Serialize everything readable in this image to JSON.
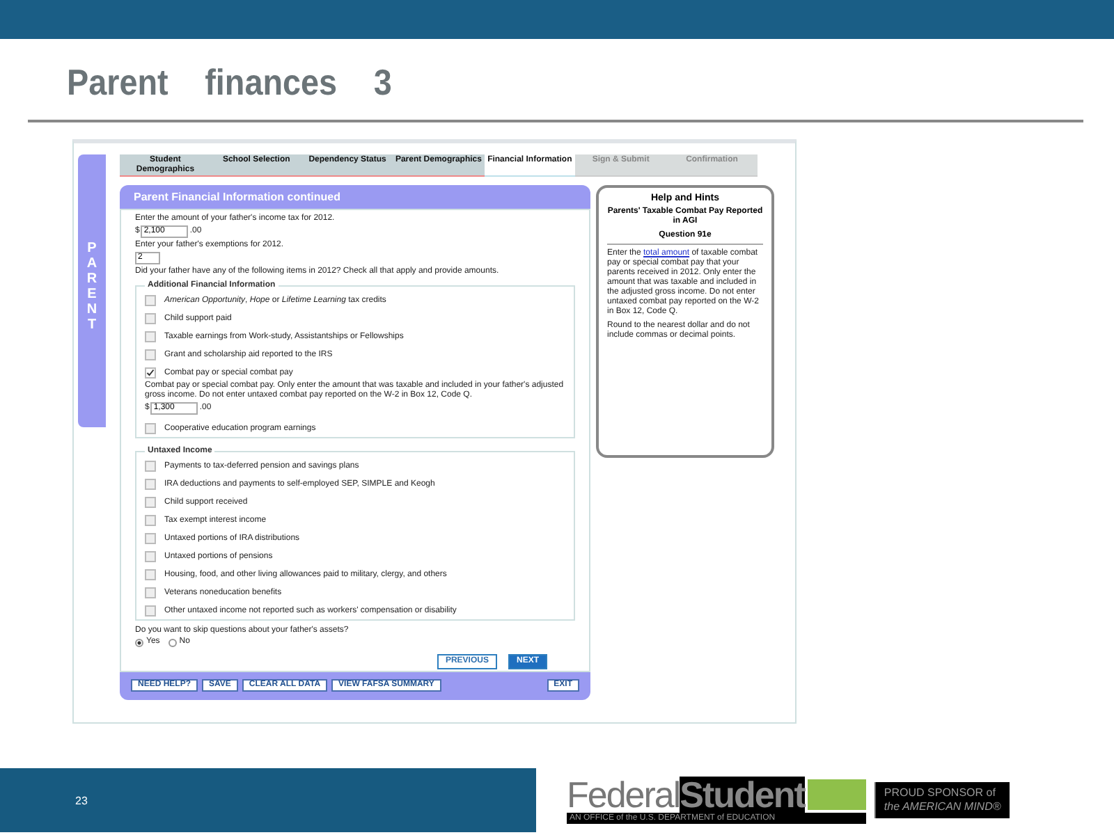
{
  "slide": {
    "title": "Parent finances 3",
    "page_number": "23"
  },
  "side_tab": {
    "label": "PARENT"
  },
  "wizard_steps": [
    {
      "label": "Student Demographics",
      "selected": false,
      "disabled": false
    },
    {
      "label": "School Selection",
      "selected": false,
      "disabled": false
    },
    {
      "label": "Dependency Status",
      "selected": false,
      "disabled": false
    },
    {
      "label": "Parent Demographics",
      "selected": false,
      "disabled": false
    },
    {
      "label": "Financial Information",
      "selected": true,
      "disabled": false
    },
    {
      "label": "Sign & Submit",
      "selected": false,
      "disabled": true
    },
    {
      "label": "Confirmation",
      "selected": false,
      "disabled": true
    }
  ],
  "form": {
    "heading": "Parent Financial Information continued",
    "questions": [
      {
        "label": "Enter the amount of your father's income tax for 2012.",
        "prefix": "$",
        "value": "2,100",
        "suffix": ".00"
      },
      {
        "label": "Enter your father's exemptions for 2012.",
        "value": "2"
      }
    ],
    "intro": "Did your father have any of the following items in 2012? Check all that apply and provide amounts.",
    "fieldsets": [
      {
        "legend": "Additional Financial Information",
        "items": [
          {
            "label": "*American Opportunity*, *Hope* or *Lifetime Learning* tax credits",
            "checked": false
          },
          {
            "label": "Child support paid",
            "checked": false
          },
          {
            "label": "Taxable earnings from Work-study, Assistantships or Fellowships",
            "checked": false
          },
          {
            "label": "Grant and scholarship aid reported to the IRS",
            "checked": false
          },
          {
            "label": "Combat pay or special combat pay",
            "checked": true,
            "detail": {
              "text": "Combat pay or special combat pay. Only enter the amount that was taxable and included in your father's adjusted gross income. Do not enter untaxed combat pay reported on the W-2 in Box 12, Code Q.",
              "prefix": "$",
              "value": "1,300",
              "suffix": ".00"
            }
          },
          {
            "label": "Cooperative education program earnings",
            "checked": false
          }
        ]
      },
      {
        "legend": "Untaxed Income",
        "items": [
          {
            "label": "Payments to tax-deferred pension and savings plans",
            "checked": false
          },
          {
            "label": "IRA deductions and payments to self-employed SEP, SIMPLE and Keogh",
            "checked": false
          },
          {
            "label": "Child support received",
            "checked": false
          },
          {
            "label": "Tax exempt interest income",
            "checked": false
          },
          {
            "label": "Untaxed portions of IRA distributions",
            "checked": false
          },
          {
            "label": "Untaxed portions of pensions",
            "checked": false
          },
          {
            "label": "Housing, food, and other living allowances paid to military, clergy, and others",
            "checked": false
          },
          {
            "label": "Veterans noneducation benefits",
            "checked": false
          },
          {
            "label": "Other untaxed income not reported such as workers' compensation or disability",
            "checked": false
          }
        ]
      }
    ],
    "skip_question": {
      "label": "Do you want to skip questions about your father's assets?",
      "options": [
        {
          "label": "Yes",
          "selected": true
        },
        {
          "label": "No",
          "selected": false
        }
      ]
    },
    "nav_buttons": [
      "PREVIOUS",
      "NEXT"
    ],
    "footer_buttons": [
      "NEED HELP?",
      "SAVE",
      "CLEAR ALL DATA",
      "VIEW FAFSA SUMMARY"
    ],
    "exit_button": "EXIT"
  },
  "help": {
    "title": "Help and Hints",
    "subtitle": "Parents' Taxable Combat Pay Reported in AGI",
    "question": "Question 91e",
    "body_before": "Enter the ",
    "body_link": "total amount",
    "body_after": " of taxable combat pay or special combat pay that your parents received in 2012. Only enter the amount that was taxable and included in the adjusted gross income. Do not enter untaxed combat pay reported on the W-2 in Box 12, Code Q.",
    "note": "Round to the nearest dollar and do not include commas or decimal points."
  },
  "logo": {
    "word1": "Federal",
    "word2": "Student",
    "tagline": "AN OFFICE of the U.S. DEPARTMENT of EDUCATION",
    "sponsor_line1": "PROUD SPONSOR of",
    "sponsor_line2": "the AMERICAN MIND®"
  }
}
